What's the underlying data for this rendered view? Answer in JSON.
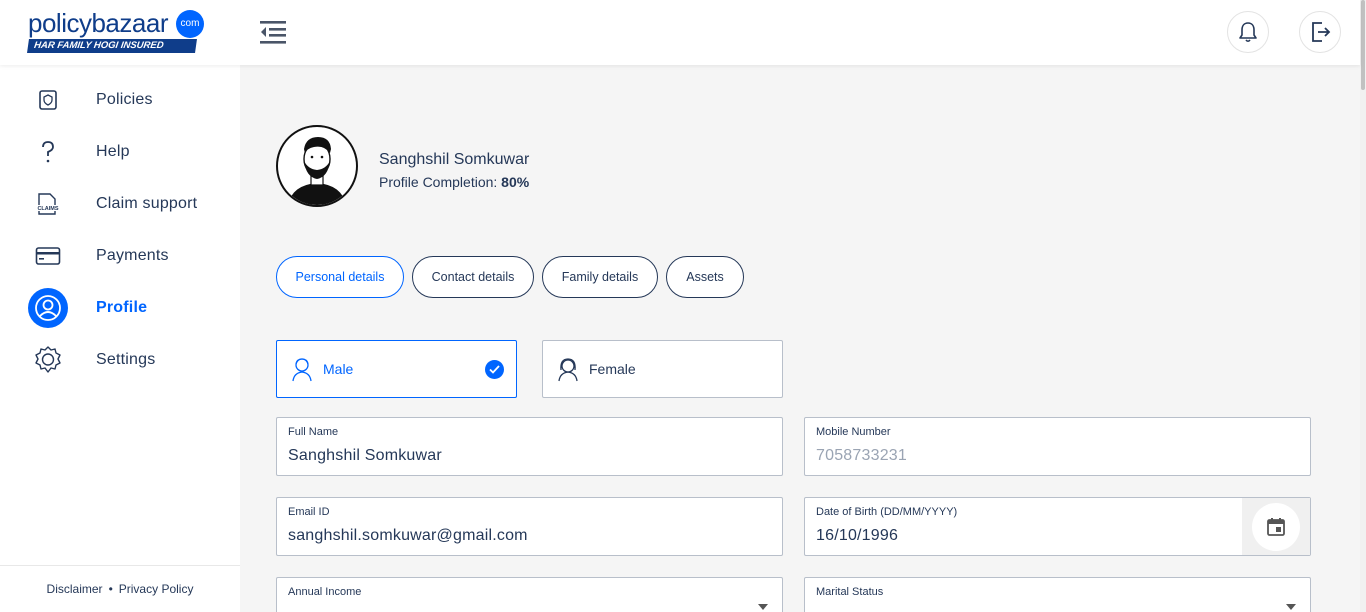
{
  "header": {
    "logo_main": "policybazaar",
    "logo_com": "com",
    "logo_tagline": "HAR FAMILY HOGI INSURED"
  },
  "sidebar": {
    "items": [
      {
        "label": "Policies",
        "icon": "policy-shield-icon"
      },
      {
        "label": "Help",
        "icon": "question-icon"
      },
      {
        "label": "Claim support",
        "icon": "claims-doc-icon"
      },
      {
        "label": "Payments",
        "icon": "card-icon"
      },
      {
        "label": "Profile",
        "icon": "user-icon",
        "active": true
      },
      {
        "label": "Settings",
        "icon": "gear-icon"
      }
    ],
    "footer": {
      "disclaimer": "Disclaimer",
      "separator": "•",
      "privacy": "Privacy Policy"
    }
  },
  "profile": {
    "name": "Sanghshil Somkuwar",
    "completion_label": "Profile Completion:",
    "completion_value": "80%"
  },
  "tabs": [
    {
      "label": "Personal details",
      "active": true
    },
    {
      "label": "Contact details"
    },
    {
      "label": "Family details"
    },
    {
      "label": "Assets"
    }
  ],
  "gender": {
    "male": "Male",
    "female": "Female",
    "selected": "Male"
  },
  "form": {
    "full_name": {
      "label": "Full Name",
      "value": "Sanghshil Somkuwar"
    },
    "mobile": {
      "label": "Mobile Number",
      "value": "7058733231"
    },
    "email": {
      "label": "Email ID",
      "value": "sanghshil.somkuwar@gmail.com"
    },
    "dob": {
      "label": "Date of Birth (DD/MM/YYYY)",
      "value": "16/10/1996"
    },
    "income": {
      "label": "Annual Income"
    },
    "marital": {
      "label": "Marital Status"
    }
  },
  "colors": {
    "accent": "#0065ff",
    "text": "#253858",
    "brand": "#0f3d8a"
  }
}
